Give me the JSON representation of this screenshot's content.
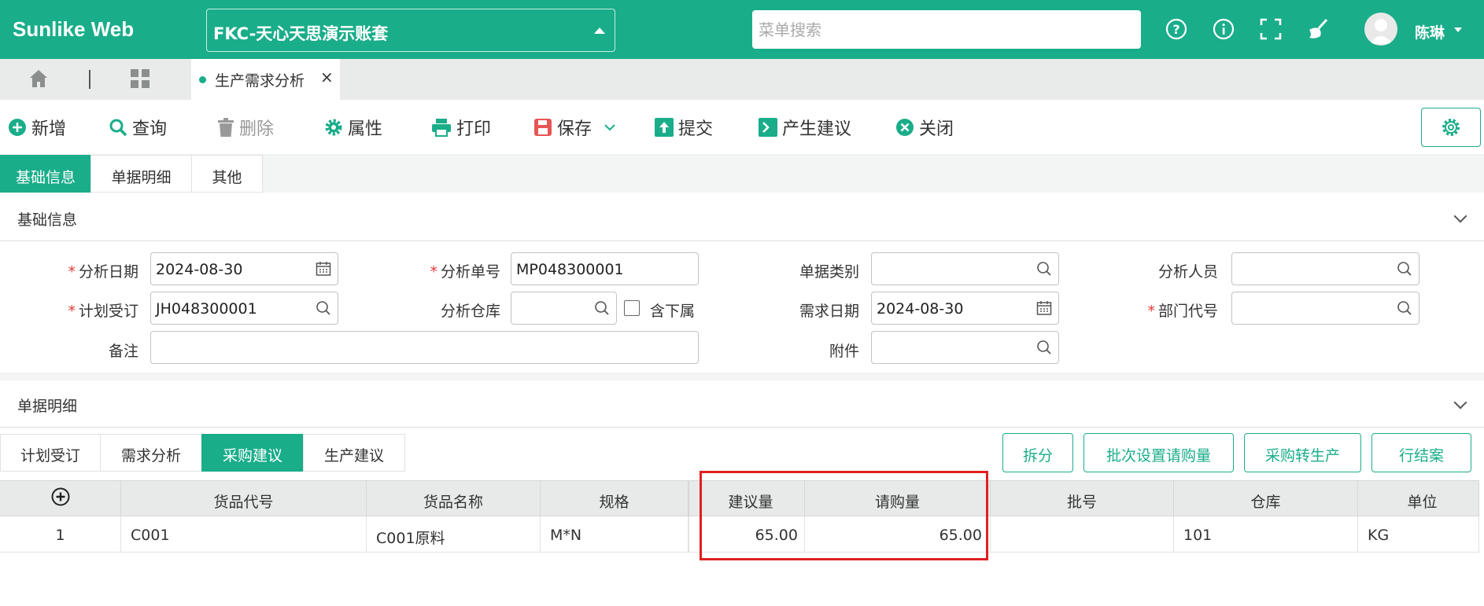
{
  "app": {
    "brand": "Sunlike Web",
    "account": "FKC-天心天思演示账套",
    "search_placeholder": "菜单搜索",
    "user": "陈琳"
  },
  "colors": {
    "primary": "#1aad8a",
    "required": "#e53935",
    "highlight_box": "#e02020"
  },
  "tabs": {
    "open_tab": "生产需求分析"
  },
  "toolbar": {
    "new": "新增",
    "query": "查询",
    "delete": "删除",
    "properties": "属性",
    "print": "打印",
    "save": "保存",
    "submit": "提交",
    "generate_suggestion": "产生建议",
    "close": "关闭"
  },
  "subtabs": [
    "基础信息",
    "单据明细",
    "其他"
  ],
  "basic_section": {
    "title": "基础信息",
    "analysis_date": {
      "label": "分析日期",
      "value": "2024-08-30"
    },
    "analysis_no": {
      "label": "分析单号",
      "value": "MP048300001"
    },
    "doc_type": {
      "label": "单据类别",
      "value": ""
    },
    "analyst": {
      "label": "分析人员",
      "value": ""
    },
    "plan_order": {
      "label": "计划受订",
      "value": "JH048300001"
    },
    "warehouse": {
      "label": "分析仓库",
      "value": ""
    },
    "include_sub": {
      "label": "含下属",
      "checked": false
    },
    "demand_date": {
      "label": "需求日期",
      "value": "2024-08-30"
    },
    "dept_code": {
      "label": "部门代号",
      "value": ""
    },
    "remark": {
      "label": "备注",
      "value": ""
    },
    "attachment": {
      "label": "附件",
      "value": ""
    }
  },
  "detail_section": {
    "title": "单据明细",
    "tabs": [
      "计划受订",
      "需求分析",
      "采购建议",
      "生产建议"
    ],
    "active_tab": 2,
    "actions": [
      "拆分",
      "批次设置请购量",
      "采购转生产",
      "行结案"
    ],
    "columns": [
      "货品代号",
      "货品名称",
      "规格",
      "建议量",
      "请购量",
      "批号",
      "仓库",
      "单位"
    ],
    "rows": [
      {
        "no": "1",
        "code": "C001",
        "name": "C001原料",
        "spec": "M*N",
        "suggest": "65.00",
        "request": "65.00",
        "batch": "",
        "warehouse": "101",
        "unit": "KG"
      }
    ]
  }
}
